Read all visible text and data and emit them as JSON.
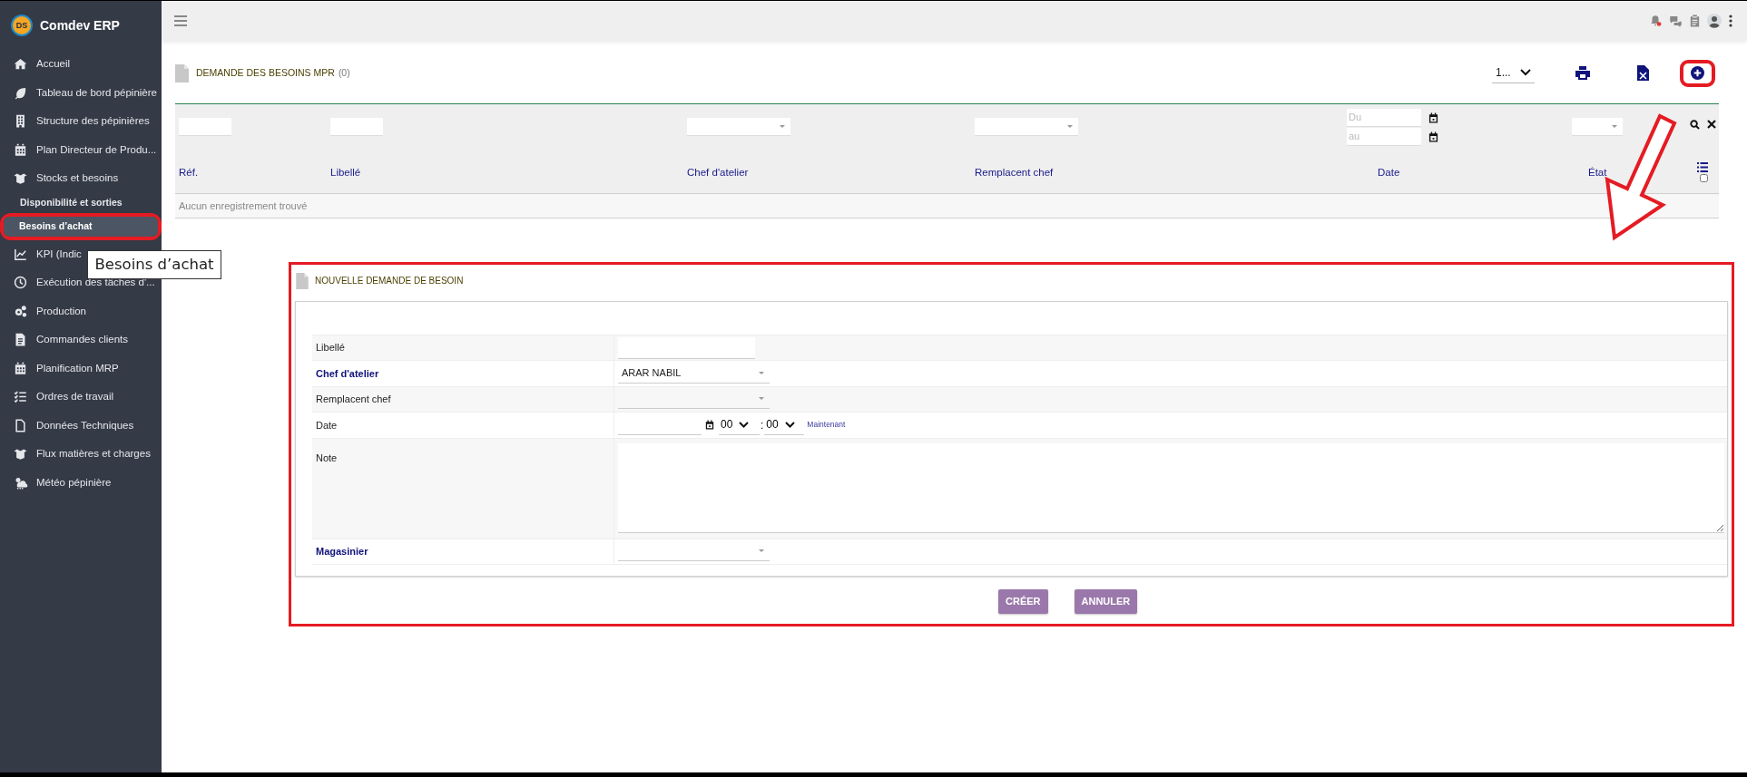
{
  "app": {
    "logo": "DS",
    "name": "Comdev ERP"
  },
  "sidebar": {
    "items": [
      {
        "label": "Accueil",
        "kind": "main",
        "selected": false
      },
      {
        "label": "Tableau de bord pépinière",
        "kind": "main",
        "selected": false
      },
      {
        "label": "Structure des pépinières",
        "kind": "main",
        "selected": false
      },
      {
        "label": "Plan Directeur de Produ...",
        "kind": "main",
        "selected": false
      },
      {
        "label": "Stocks et besoins",
        "kind": "main",
        "selected": false
      },
      {
        "label": "Disponibilité et sorties",
        "kind": "sub",
        "selected": false
      },
      {
        "label": "Besoins d’achat",
        "kind": "sub",
        "selected": true
      },
      {
        "label": "KPI (Indic",
        "kind": "main",
        "selected": false
      },
      {
        "label": "Exécution des tâches d'...",
        "kind": "main",
        "selected": false
      },
      {
        "label": "Production",
        "kind": "main",
        "selected": false
      },
      {
        "label": "Commandes clients",
        "kind": "main",
        "selected": false
      },
      {
        "label": "Planification MRP",
        "kind": "main",
        "selected": false
      },
      {
        "label": "Ordres de travail",
        "kind": "main",
        "selected": false
      },
      {
        "label": "Données Techniques",
        "kind": "main",
        "selected": false
      },
      {
        "label": "Flux matières et charges",
        "kind": "main",
        "selected": false
      },
      {
        "label": "Météo pépinière",
        "kind": "main",
        "selected": false
      }
    ]
  },
  "tooltip": "Besoins d’achat",
  "list": {
    "title": "DEMANDE DES BESOINS MPR",
    "count": "(0)",
    "page_size": "1...",
    "filters": [
      {
        "kind": "text"
      },
      {
        "kind": "text"
      },
      {
        "kind": "select"
      },
      {
        "kind": "select"
      },
      {
        "kind": "daterange",
        "from_placeholder": "Du",
        "to_placeholder": "au"
      },
      {
        "kind": "select"
      }
    ],
    "columns": [
      "Réf.",
      "Libellé",
      "Chef d'atelier",
      "Remplacent chef",
      "Date",
      "État"
    ],
    "select_all_checked": false,
    "empty_message": "Aucun enregistrement trouvé"
  },
  "form": {
    "title": "NOUVELLE DEMANDE DE BESOIN",
    "fields": [
      {
        "label": "Libellé",
        "kind": "text",
        "required": false
      },
      {
        "label": "Chef d'atelier",
        "kind": "select",
        "required": true,
        "value": "ARAR NABIL"
      },
      {
        "label": "Remplacent chef",
        "kind": "select",
        "required": false
      },
      {
        "label": "Date",
        "kind": "datetime",
        "required": false,
        "hour": "00",
        "separator": ":",
        "minute": "00",
        "now_link": "Maintenant"
      },
      {
        "label": "Note",
        "kind": "textarea",
        "required": false
      },
      {
        "label": "Magasinier",
        "kind": "select",
        "required": true
      }
    ],
    "buttons": [
      "CRÉER",
      "ANNULER"
    ]
  }
}
